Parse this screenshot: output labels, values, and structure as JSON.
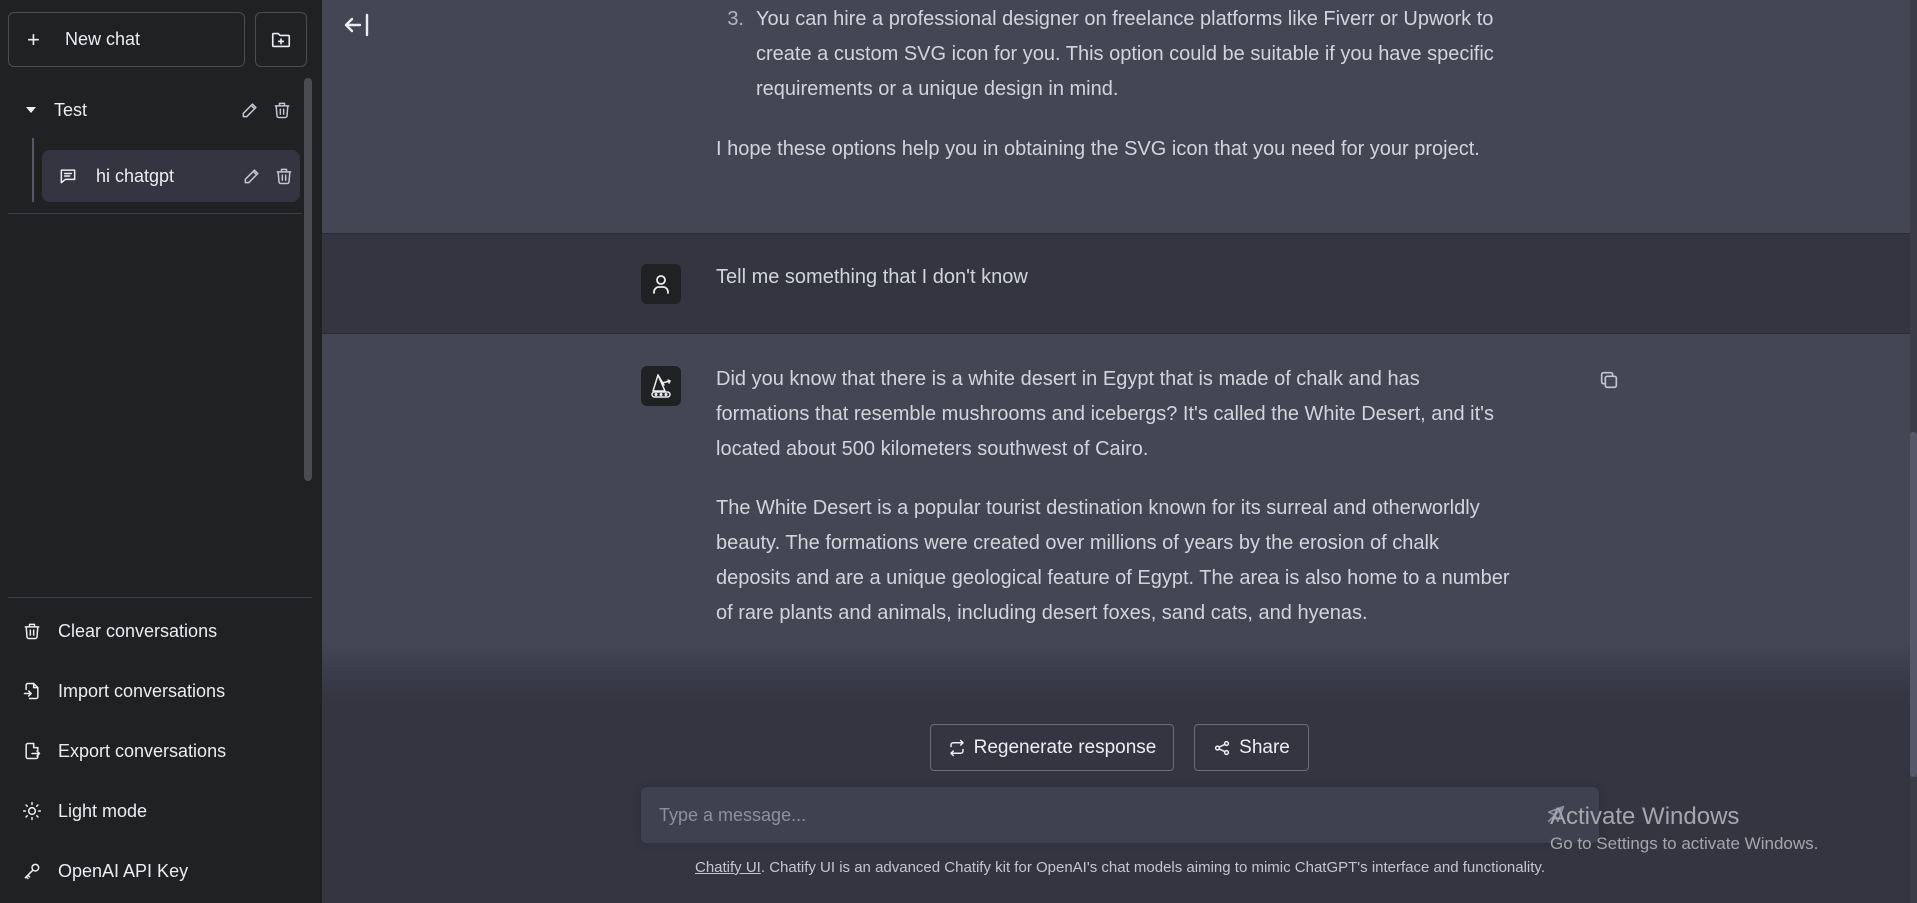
{
  "sidebar": {
    "new_chat_label": "New chat",
    "folder": {
      "name": "Test"
    },
    "chat_item": {
      "name": "hi chatgpt"
    },
    "bottom_items": [
      {
        "label": "Clear conversations",
        "icon": "trash-icon"
      },
      {
        "label": "Import conversations",
        "icon": "file-import-icon"
      },
      {
        "label": "Export conversations",
        "icon": "file-export-icon"
      },
      {
        "label": "Light mode",
        "icon": "sun-icon"
      },
      {
        "label": "OpenAI API Key",
        "icon": "key-icon"
      }
    ]
  },
  "conversation": {
    "list_item": {
      "number": "3.",
      "text": "You can hire a professional designer on freelance platforms like Fiverr or Upwork to create a custom SVG icon for you. This option could be suitable if you have specific requirements or a unique design in mind."
    },
    "assistant_closing": "I hope these options help you in obtaining the SVG icon that you need for your project.",
    "user_message": "Tell me something that I don't know",
    "assistant_reply": {
      "p1": "Did you know that there is a white desert in Egypt that is made of chalk and has formations that resemble mushrooms and icebergs? It's called the White Desert, and it's located about 500 kilometers southwest of Cairo.",
      "p2": "The White Desert is a popular tourist destination known for its surreal and otherworldly beauty. The formations were created over millions of years by the erosion of chalk deposits and are a unique geological feature of Egypt. The area is also home to a number of rare plants and animals, including desert foxes, sand cats, and hyenas."
    }
  },
  "actions": {
    "regenerate_label": "Regenerate response",
    "share_label": "Share"
  },
  "composer": {
    "placeholder": "Type a message...",
    "value": ""
  },
  "footer": {
    "link_text": "Chatify UI",
    "text": ". Chatify UI is an advanced Chatify kit for OpenAI's chat models aiming to mimic ChatGPT's interface and functionality."
  },
  "overlay": {
    "line1": "Activate Windows",
    "line2": "Go to Settings to activate Windows."
  },
  "colors": {
    "sidebar_bg": "#202123",
    "main_bg": "#343541",
    "assistant_bg": "#444654",
    "composer_bg": "#40414f",
    "text": "#ececf1"
  }
}
